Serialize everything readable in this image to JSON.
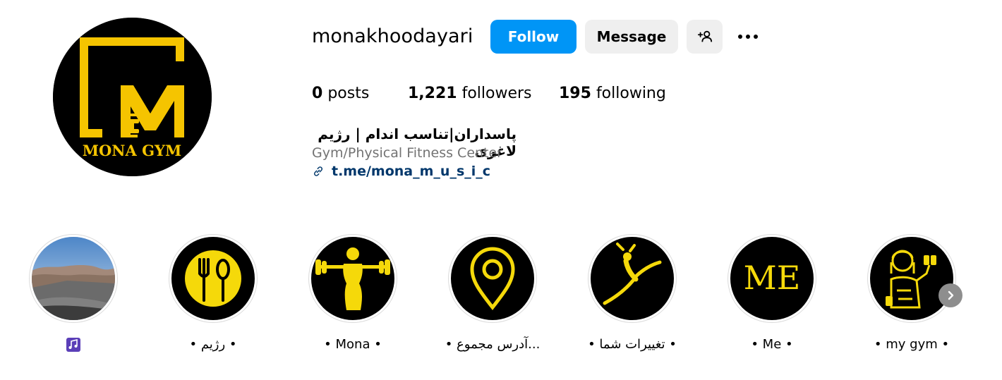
{
  "profile": {
    "username": "monakhoodayari",
    "avatar_icon": "mona-gym-logo",
    "avatar_brand_text": "MONA GYM",
    "accent_color": "#f5c400"
  },
  "actions": {
    "follow_label": "Follow",
    "message_label": "Message",
    "add_user_icon": "person-plus-icon",
    "more_icon": "more-horizontal-icon"
  },
  "stats": {
    "posts_count": "0",
    "posts_label": "posts",
    "followers_count": "1,221",
    "followers_label": "followers",
    "following_count": "195",
    "following_label": "following"
  },
  "bio": {
    "name": "پاسداران|تناسب اندام | رژیم لاغری",
    "category": "Gym/Physical Fitness Center",
    "link_text": "t.me/mona_m_u_s_i_c",
    "link_icon": "link-icon"
  },
  "highlights": [
    {
      "label": "",
      "icon": "music-note-icon",
      "cover": "road-landscape-photo"
    },
    {
      "label": "• رژیم •",
      "icon": "fork-spoon-icon",
      "cover": "fork-spoon-icon"
    },
    {
      "label": "• Mona •",
      "icon": "barbell-woman-icon",
      "cover": "barbell-woman-icon"
    },
    {
      "label": "• آدرس مجموع...",
      "icon": "location-pin-icon",
      "cover": "location-pin-icon"
    },
    {
      "label": "• تغییرات شما •",
      "icon": "dancer-leap-icon",
      "cover": "dancer-leap-icon"
    },
    {
      "label": "• Me •",
      "icon": "me-text-icon",
      "cover_text": "ME"
    },
    {
      "label": "• my gym •",
      "icon": "woman-dumbbell-icon",
      "cover": "woman-dumbbell-icon"
    }
  ],
  "navigation": {
    "next_icon": "chevron-right-icon"
  }
}
